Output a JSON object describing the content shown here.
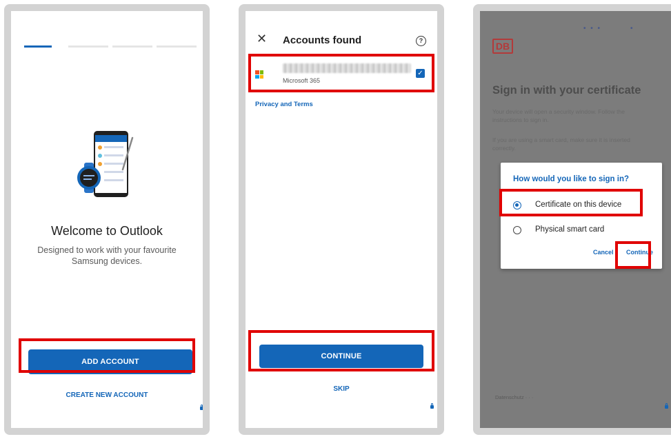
{
  "panel1": {
    "welcome_title": "Welcome to Outlook",
    "welcome_subtitle": "Designed to work with your favourite Samsung devices.",
    "add_account": "ADD ACCOUNT",
    "create_account": "CREATE NEW ACCOUNT",
    "progress_steps": 4,
    "active_step": 1
  },
  "panel2": {
    "title": "Accounts found",
    "account_type": "Microsoft 365",
    "account_checked": true,
    "privacy_link": "Privacy and Terms",
    "continue": "CONTINUE",
    "skip": "SKIP"
  },
  "panel3": {
    "logo_text": "DB",
    "title": "Sign in with your certificate",
    "info_line1": "Your device will open a security window. Follow the instructions to sign in.",
    "info_line2": "If you are using a smart card, make sure it is inserted correctly.",
    "dialog": {
      "title": "How would you like to sign in?",
      "option1": "Certificate on this device",
      "option2": "Physical smart card",
      "selected": "Certificate on this device",
      "cancel": "Cancel",
      "continue": "Continue"
    },
    "footer": "Datenschutz  · · ·"
  },
  "colors": {
    "accent": "#1466b8",
    "highlight": "#e00000",
    "frame": "#d3d3d3",
    "overlay": "#7c7c7c"
  }
}
